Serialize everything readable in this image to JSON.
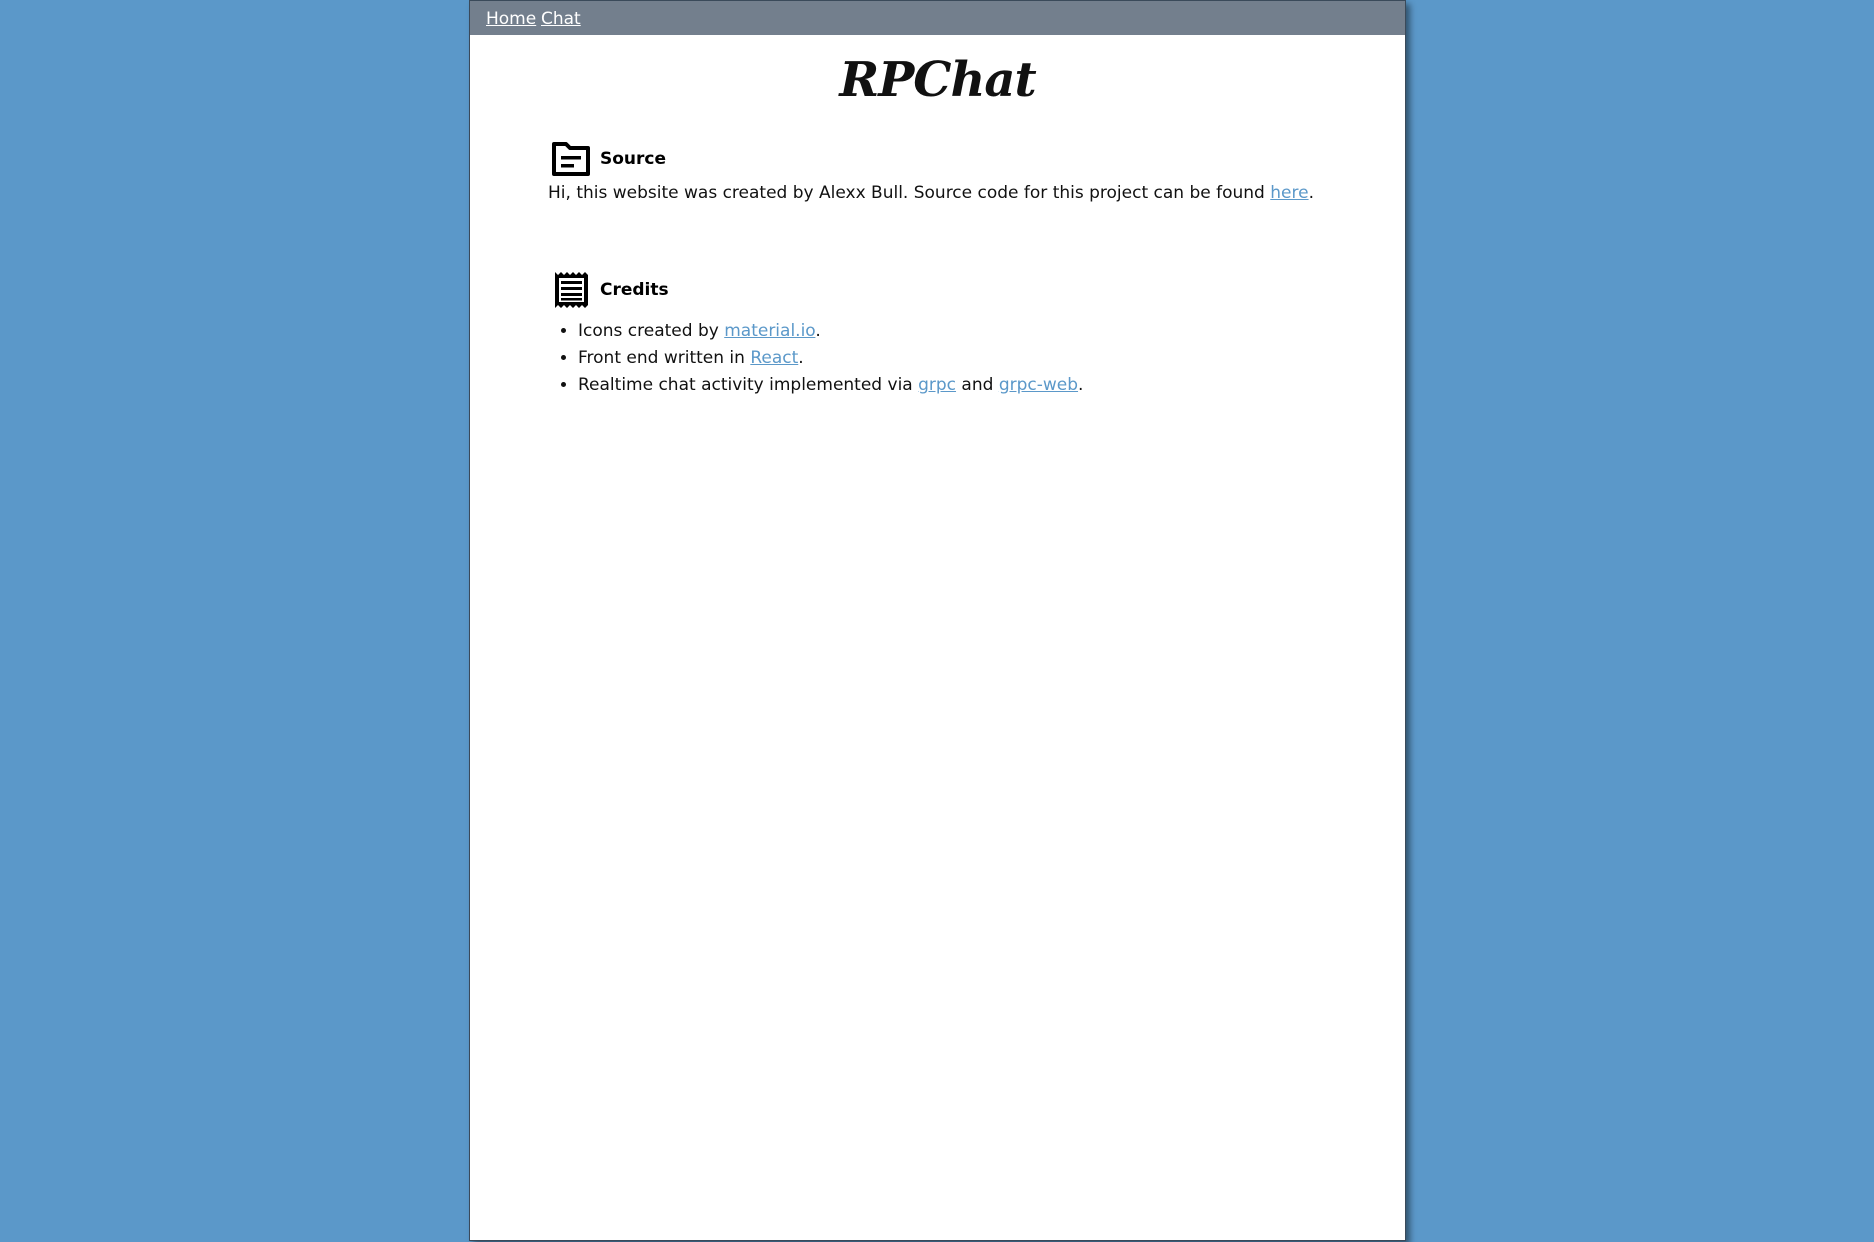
{
  "nav": {
    "home": "Home",
    "chat": "Chat"
  },
  "title": "RPChat",
  "source": {
    "heading": "Source",
    "icon": "source-folder-icon",
    "text_before": "Hi, this website was created by Alexx Bull. Source code for this project can be found ",
    "link": "here",
    "text_after": "."
  },
  "credits": {
    "heading": "Credits",
    "icon": "receipt-icon",
    "items": [
      {
        "before": "Icons created by ",
        "link": "material.io",
        "after": "."
      },
      {
        "before": "Front end written in ",
        "link": "React",
        "after": "."
      },
      {
        "before": "Realtime chat activity implemented via ",
        "link": "grpc",
        "middle": " and ",
        "link2": "grpc-web",
        "after": "."
      }
    ]
  },
  "colors": {
    "background": "#5b98c9",
    "navbar": "#737f8d",
    "link": "#5b98c9"
  }
}
